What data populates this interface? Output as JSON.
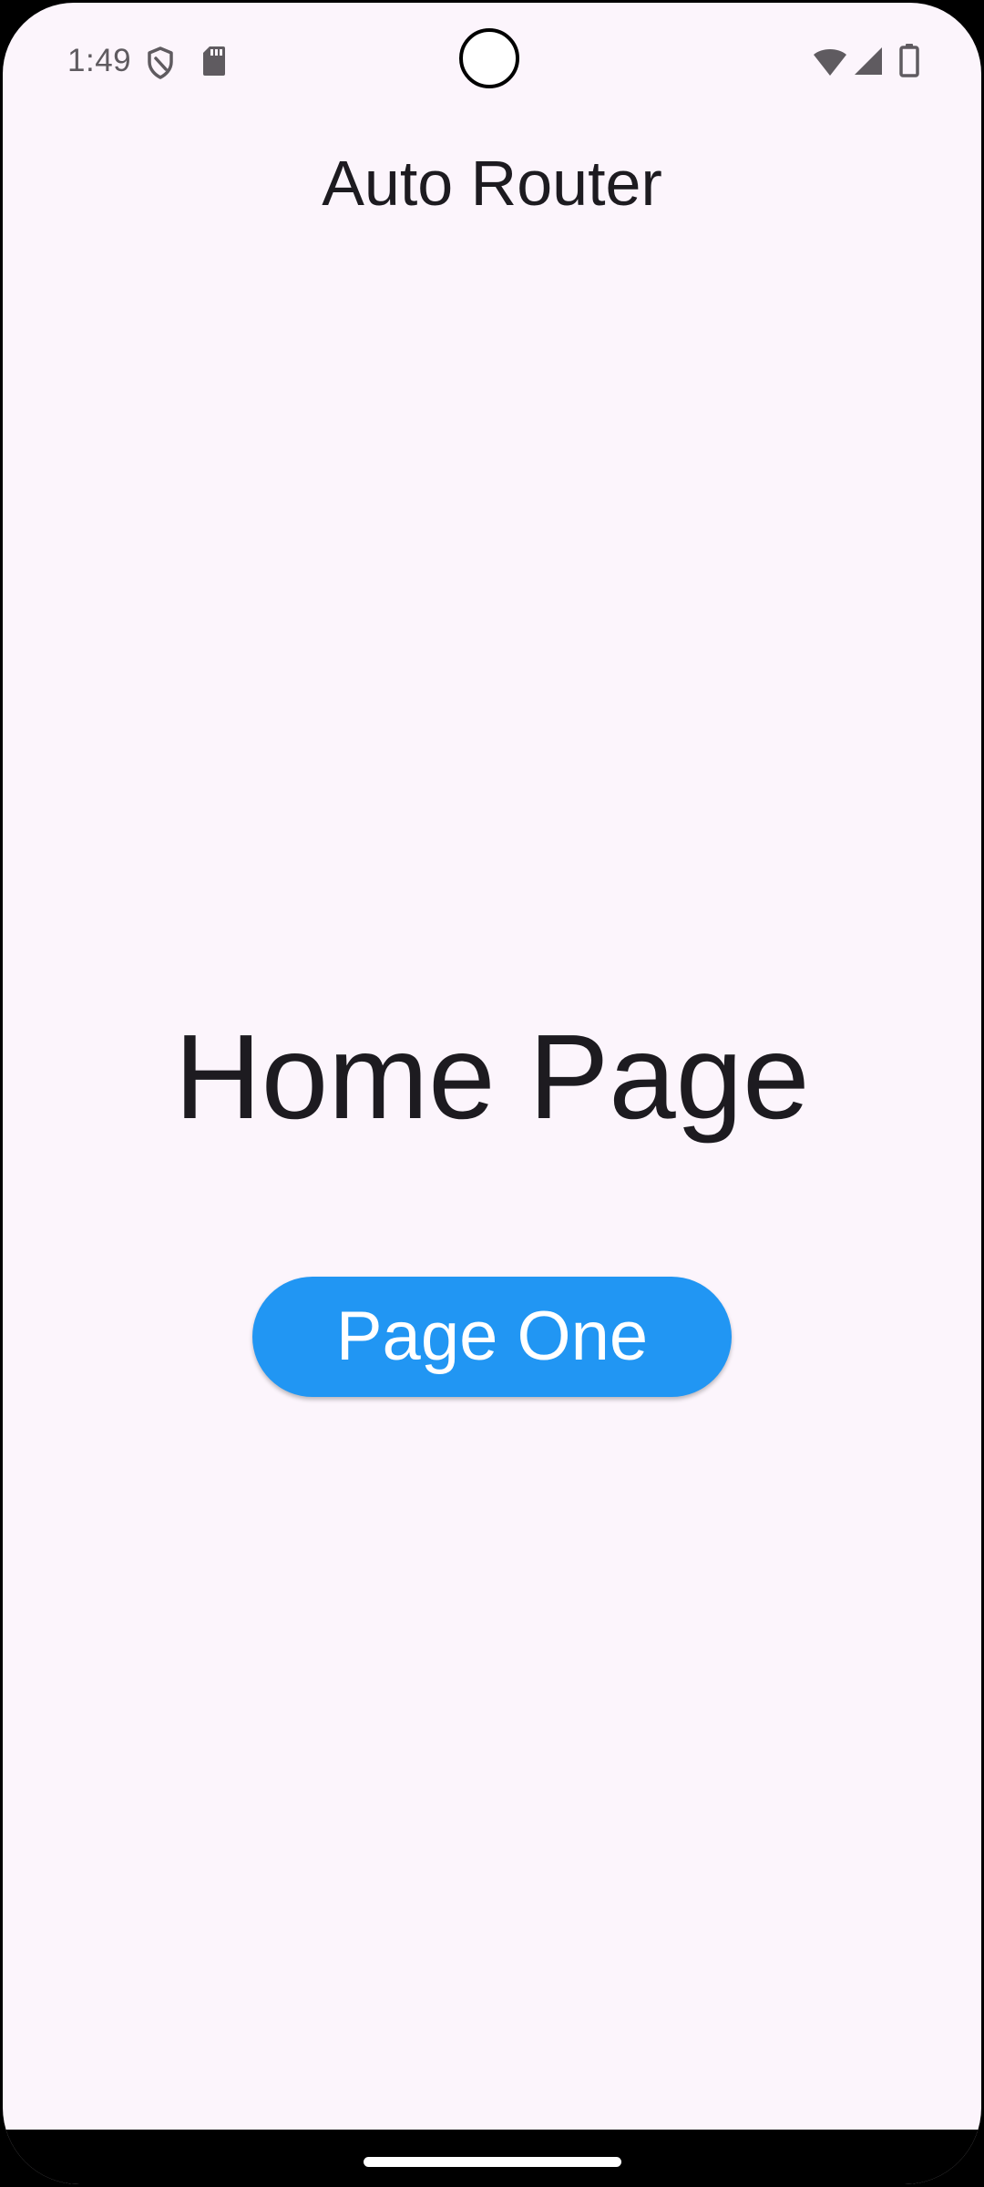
{
  "status_bar": {
    "time": "1:49",
    "left_icons": [
      "shield-icon",
      "sd-card-icon"
    ],
    "right_icons": [
      "wifi-icon",
      "cell-signal-icon",
      "battery-icon"
    ]
  },
  "app_bar": {
    "title": "Auto Router"
  },
  "main": {
    "heading": "Home Page",
    "button_label": "Page One"
  },
  "colors": {
    "background": "#fcf5fc",
    "button": "#2196f3",
    "button_text": "#ffffff",
    "text": "#1d1b20"
  }
}
